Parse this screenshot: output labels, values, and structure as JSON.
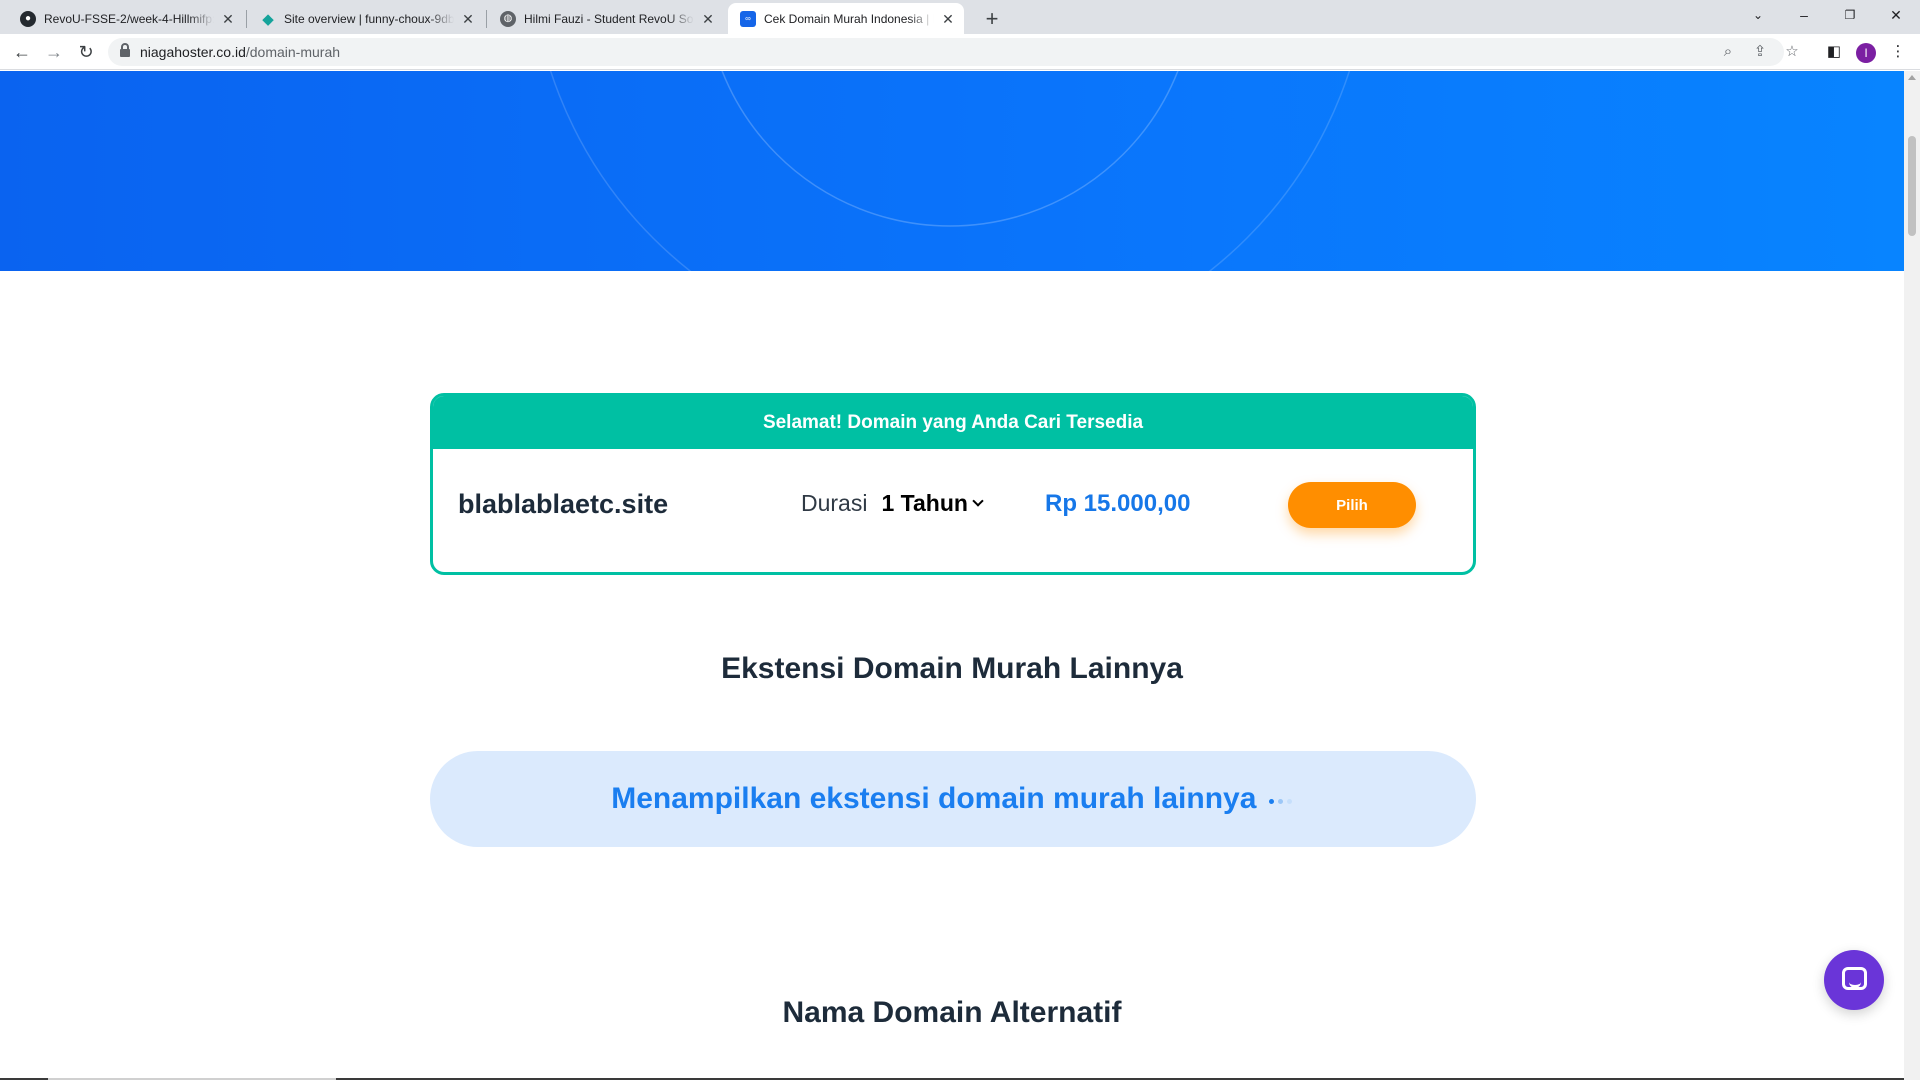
{
  "browser": {
    "tabs": [
      {
        "title": "RevoU-FSSE-2/week-4-Hillmifp: w",
        "icon": "github-icon",
        "active": false
      },
      {
        "title": "Site overview | funny-choux-9db",
        "icon": "netlify-icon",
        "active": false
      },
      {
        "title": "Hilmi Fauzi - Student RevoU Softw",
        "icon": "globe-icon",
        "active": false
      },
      {
        "title": "Cek Domain Murah Indonesia | Be",
        "icon": "niagahoster-icon",
        "active": true
      }
    ],
    "new_tab_label": "+",
    "address": {
      "host": "niagahoster.co.id",
      "path": "/domain-murah"
    },
    "profile_initial": "I",
    "colors": {
      "tabbar": "#dee1e6",
      "profile": "#7b1fa2"
    }
  },
  "result": {
    "header": "Selamat! Domain yang Anda Cari Tersedia",
    "domain": "blablablaetc.site",
    "duration_label": "Durasi",
    "duration_value": "1 Tahun",
    "price": "Rp 15.000,00",
    "button": "Pilih"
  },
  "sections": {
    "more_extensions_title": "Ekstensi Domain Murah Lainnya",
    "loading_text": "Menampilkan ekstensi domain murah lainnya",
    "alternative_title": "Nama Domain Alternatif"
  },
  "colors": {
    "hero": "#0a74fb",
    "accent_green": "#00c0a3",
    "button_orange": "#ff8e00",
    "price_blue": "#1677e8",
    "loading_bg": "#dbeafd",
    "chat_purple": "#6a35d8"
  },
  "chat_widget": {
    "icon": "chat-bubble-icon"
  }
}
